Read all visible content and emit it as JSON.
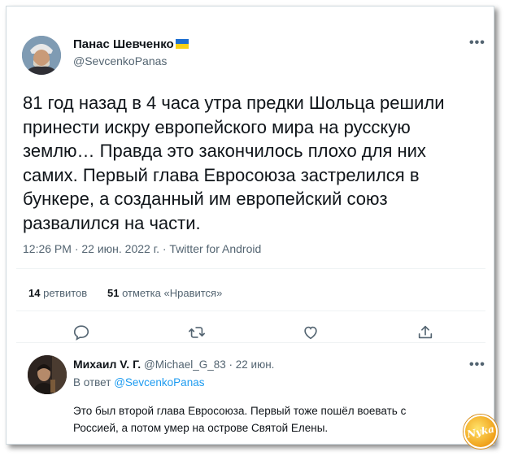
{
  "tweet": {
    "author_name": "Панас Шевченко",
    "author_handle": "@SevcenkoPanas",
    "text": "81 год назад в 4 часа утра предки Шольца решили\nпринести искру европейского мира на русскую\nземлю… Правда это закончилось плохо для них\nсамих. Первый глава Евросоюза застрелился в\nбункере, а созданный им европейский союз\nразвалился на части.",
    "meta": "12:26 PM · 22 июн. 2022 г. · Twitter for Android",
    "more_icon": "•••",
    "retweets_count": "14",
    "retweets_label": "ретвитов",
    "likes_count": "51",
    "likes_label": "отметка «Нравится»"
  },
  "actions": [
    "reply-icon",
    "retweet-icon",
    "like-icon",
    "share-icon"
  ],
  "reply": {
    "author_name": "Михаил V. Г.",
    "author_handle": "@Michael_G_83 · 22 июн.",
    "reply_to_prefix": "В ответ",
    "reply_to_handle": "@SevcenkoPanas",
    "text": "Это был второй глава Евросоюза. Первый тоже пошёл воевать с\nРоссией, а потом умер на острове Святой Елены.",
    "more_icon": "•••"
  },
  "watermark": {
    "text": "Nyka"
  },
  "colors": {
    "accent": "#1d9bf0",
    "secondary": "#536471",
    "flag_blue": "#1e6fd1",
    "flag_yellow": "#f7d117"
  }
}
